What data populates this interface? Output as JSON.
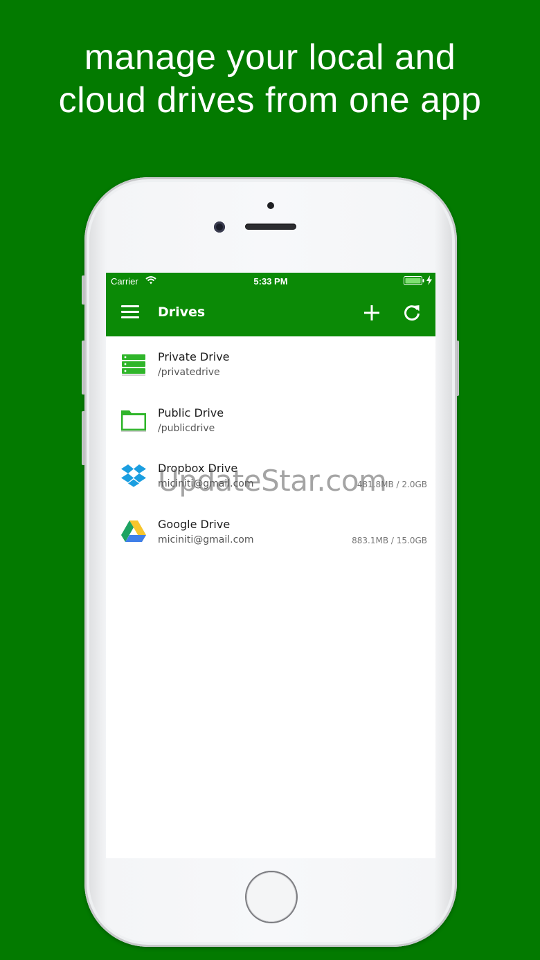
{
  "headline": {
    "line1": "manage your local and",
    "line2": "cloud drives from one app"
  },
  "status_bar": {
    "carrier": "Carrier",
    "time": "5:33 PM",
    "icons": [
      "wifi-icon",
      "battery-icon",
      "charging-icon"
    ]
  },
  "app_bar": {
    "title": "Drives",
    "icons": [
      "menu-icon",
      "add-icon",
      "refresh-icon"
    ]
  },
  "drives": [
    {
      "name": "Private Drive",
      "subtitle": "/privatedrive",
      "usage": "",
      "icon": "server-icon"
    },
    {
      "name": "Public Drive",
      "subtitle": "/publicdrive",
      "usage": "",
      "icon": "folder-icon"
    },
    {
      "name": "Dropbox Drive",
      "subtitle": "miciniti@gmail.com",
      "usage": "481.8MB / 2.0GB",
      "icon": "dropbox-icon"
    },
    {
      "name": "Google Drive",
      "subtitle": "miciniti@gmail.com",
      "usage": "883.1MB / 15.0GB",
      "icon": "google-drive-icon"
    }
  ],
  "watermark": "UpdateStar.com",
  "colors": {
    "background": "#037a00",
    "app_bar": "#0b8a06",
    "icon_green": "#2fb52a"
  }
}
